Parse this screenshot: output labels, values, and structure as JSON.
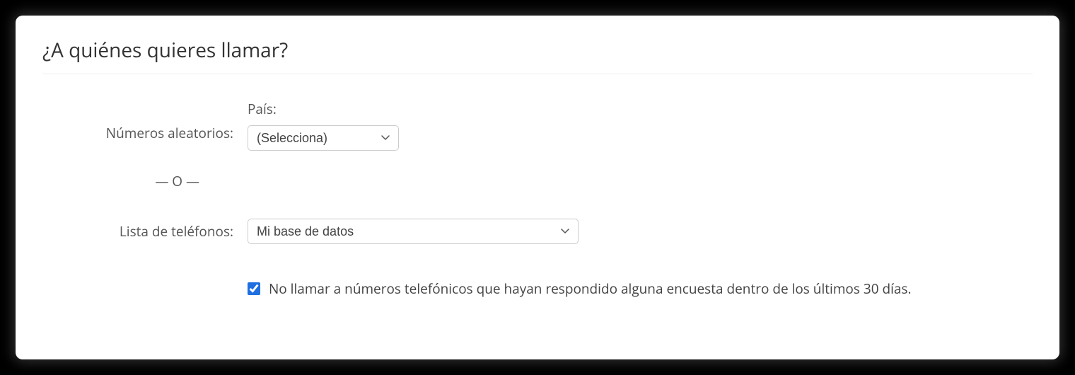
{
  "title": "¿A quiénes quieres llamar?",
  "random_numbers_label": "Números aleatorios:",
  "country_label": "País:",
  "country_select_placeholder": "(Selecciona)",
  "or_separator": "— O —",
  "phone_list_label": "Lista de teléfonos:",
  "phone_list_selected": "Mi base de datos",
  "do_not_call_checked": true,
  "do_not_call_label": "No llamar a números telefónicos que hayan respondido alguna encuesta dentro de los últimos 30 días."
}
